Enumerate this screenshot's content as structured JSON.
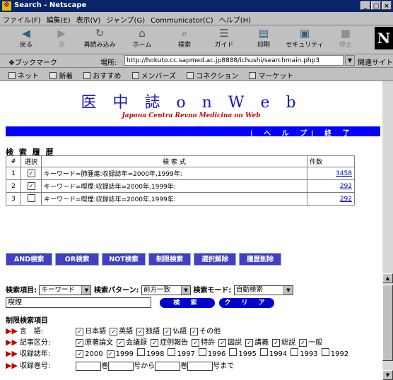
{
  "window": {
    "title": "Search - Netscape",
    "min": "_",
    "max": "□",
    "close": "×"
  },
  "menu": [
    "ファイル(F)",
    "編集(E)",
    "表示(V)",
    "ジャンプ(G)",
    "Communicator(C)",
    "ヘルプ(H)"
  ],
  "toolbar": [
    {
      "label": "戻る",
      "icon": "back-icon",
      "glyph": "◀",
      "enabled": true
    },
    {
      "label": "次",
      "icon": "forward-icon",
      "glyph": "▶",
      "enabled": false
    },
    {
      "label": "再読み込み",
      "icon": "reload-icon",
      "glyph": "↻",
      "enabled": true
    },
    {
      "label": "ホーム",
      "icon": "home-icon",
      "glyph": "⌂",
      "enabled": true
    },
    {
      "label": "検索",
      "icon": "search-icon",
      "glyph": "⌕",
      "enabled": true
    },
    {
      "label": "ガイド",
      "icon": "guide-icon",
      "glyph": "☰",
      "enabled": true
    },
    {
      "label": "印刷",
      "icon": "print-icon",
      "glyph": "▤",
      "enabled": true
    },
    {
      "label": "セキュリティ",
      "icon": "lock-icon",
      "glyph": "▣",
      "enabled": true
    },
    {
      "label": "停止",
      "icon": "stop-icon",
      "glyph": "■",
      "enabled": false
    }
  ],
  "netscape_logo": "N",
  "location": {
    "bookmarks": "ブックマーク",
    "label": "場所:",
    "url": "http://hokuto.cc.sapmed.ac.jp8888/ichushi/searchmain.php3",
    "related": "関連サイト"
  },
  "personal_bar": [
    "ネット",
    "新着",
    "おすすめ",
    "メンバーズ",
    "コネクション",
    "マーケット"
  ],
  "page": {
    "logo": "医 中 誌  o n  W e b",
    "subtitle": "Japana Centra Revuo Medicina on Web",
    "help": "| ヘ ル プ",
    "exit": "| 終 了",
    "history_title": "検 索 履 歴",
    "history_headers": [
      "#",
      "選択",
      "検 索 式",
      "件数"
    ],
    "history": [
      {
        "num": "1",
        "checked": true,
        "query": "キーワード=肺腫瘍:収録誌年=2000年,1999年:",
        "count": "3458"
      },
      {
        "num": "2",
        "checked": true,
        "query": "キーワード=喫煙:収録誌年=2000年,1999年:",
        "count": "292"
      },
      {
        "num": "3",
        "checked": false,
        "query": "キーワード=喫煙:収録誌年=2000年,1999年:",
        "count": "292"
      }
    ],
    "buttons": [
      "AND検索",
      "OR検索",
      "NOT検索",
      "制限検索",
      "選択解除",
      "履歴削除"
    ],
    "search_item_label": "検索項目:",
    "search_item_value": "キーワード",
    "pattern_label": "検索パターン:",
    "pattern_value": "前方一致",
    "mode_label": "検索モード:",
    "mode_value": "自動検索",
    "keyword": "喫煙",
    "search_button": "検 索",
    "clear_button": "ク リ ア",
    "limits_title": "制限検索項目",
    "language_label": "言　語:",
    "languages": [
      {
        "label": "日本語",
        "checked": true
      },
      {
        "label": "英語",
        "checked": true
      },
      {
        "label": "独語",
        "checked": true
      },
      {
        "label": "仏語",
        "checked": true
      },
      {
        "label": "その他",
        "checked": true
      }
    ],
    "article_label": "記事区分:",
    "articles": [
      {
        "label": "原著論文",
        "checked": true
      },
      {
        "label": "会議録",
        "checked": true
      },
      {
        "label": "症例報告",
        "checked": true
      },
      {
        "label": "特許",
        "checked": true
      },
      {
        "label": "図説",
        "checked": true
      },
      {
        "label": "講義",
        "checked": true
      },
      {
        "label": "総説",
        "checked": true
      },
      {
        "label": "一般",
        "checked": true
      }
    ],
    "year_label": "収録誌年:",
    "years": [
      {
        "label": "2000",
        "checked": true
      },
      {
        "label": "1999",
        "checked": true
      },
      {
        "label": "1998",
        "checked": false
      },
      {
        "label": "1997",
        "checked": false
      },
      {
        "label": "1996",
        "checked": false
      },
      {
        "label": "1995",
        "checked": false
      },
      {
        "label": "1994",
        "checked": false
      },
      {
        "label": "1993",
        "checked": false
      },
      {
        "label": "1992",
        "checked": false
      }
    ],
    "volume_label": "収録巻号:",
    "vol_text1": "巻",
    "vol_text2": "号から",
    "vol_text3": "巻",
    "vol_text4": "号まで"
  }
}
